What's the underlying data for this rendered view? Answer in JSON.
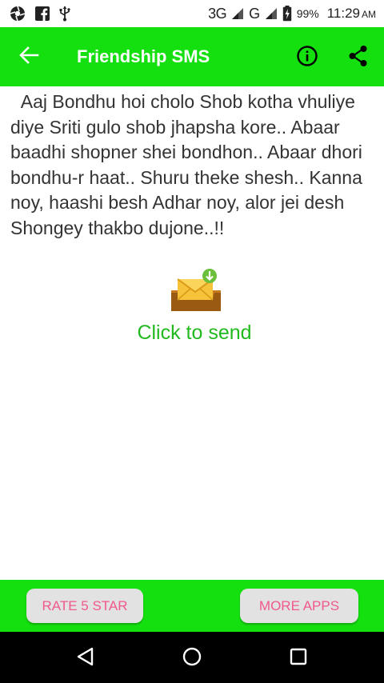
{
  "status_bar": {
    "icons": [
      "aperture-icon",
      "facebook-icon",
      "usb-icon"
    ],
    "network_1": "3G",
    "network_2": "G",
    "battery_pct": "99%",
    "time": "11:29",
    "ampm": "AM"
  },
  "app_bar": {
    "title": "Friendship SMS",
    "back_icon": "arrow-left-icon",
    "info_icon": "info-icon",
    "share_icon": "share-icon",
    "color": "#14e00f"
  },
  "content": {
    "sms_text": "  Aaj Bondhu hoi cholo Shob kotha vhuliye diye Sriti gulo shob jhapsha kore.. Abaar baadhi shopner shei bondhon.. Abaar dhori bondhu-r haat.. Shuru theke shesh.. Kanna noy, haashi besh Adhar noy, alor jei desh Shongey thakbo dujone..!!",
    "send_icon": "envelope-download-icon",
    "send_label": "Click to send",
    "send_label_color": "#22b91f"
  },
  "bottom_bar": {
    "rate_label": "RATE 5 STAR",
    "more_label": "MORE APPS",
    "label_color": "#f0598a"
  },
  "nav_bar": {
    "icons": [
      "nav-back-icon",
      "nav-home-icon",
      "nav-recents-icon"
    ]
  }
}
